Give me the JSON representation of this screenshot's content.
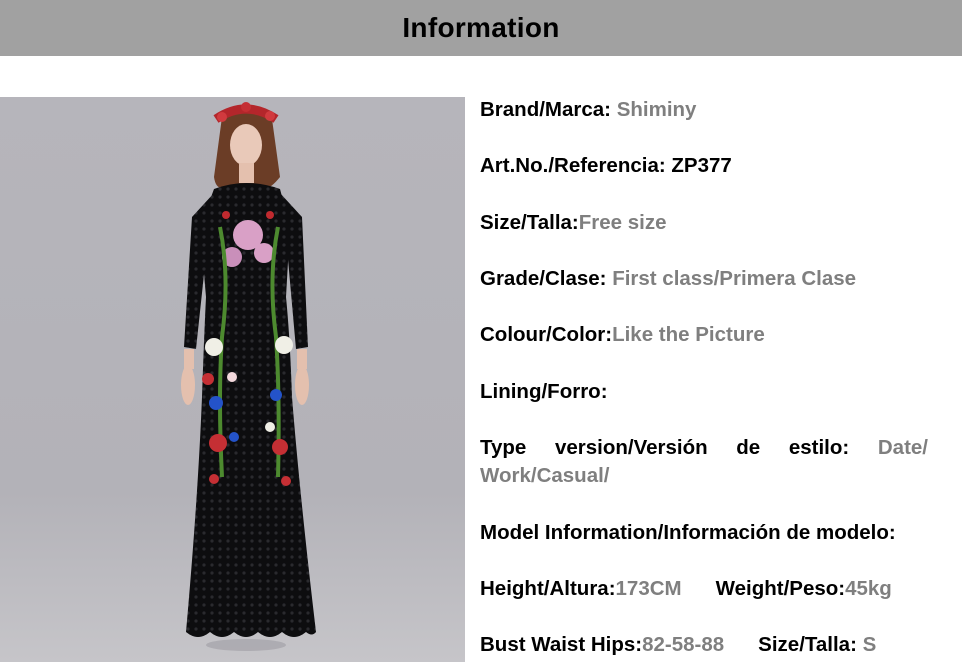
{
  "header": {
    "title": "Information"
  },
  "photo": {
    "description_icon": "product-photo"
  },
  "info": {
    "brand": {
      "label": "Brand/Marca:",
      "value": "Shiminy"
    },
    "art": {
      "label": "Art.No./Referencia:",
      "value": "ZP377"
    },
    "size": {
      "label": "Size/Talla:",
      "value": "Free size"
    },
    "grade": {
      "label": "Grade/Clase:",
      "value": "First class/Primera Clase"
    },
    "colour": {
      "label": "Colour/Color:",
      "value": "Like the Picture"
    },
    "lining": {
      "label": "Lining/Forro:",
      "value": ""
    },
    "type": {
      "label": "Type version/Versión de estilo:",
      "value": "Date/ Work/Casual/"
    },
    "model": {
      "label": "Model Information/Información de modelo:"
    },
    "height": {
      "label": "Height/Altura:",
      "value": "173CM"
    },
    "weight": {
      "label": "Weight/Peso:",
      "value": "45kg"
    },
    "bust": {
      "label": "Bust Waist Hips:",
      "value": "82-58-88"
    },
    "model_size": {
      "label": "Size/Talla:",
      "value": "S"
    }
  },
  "colors": {
    "header_bg": "#a1a1a1",
    "value_gray": "#7f7f7f"
  }
}
